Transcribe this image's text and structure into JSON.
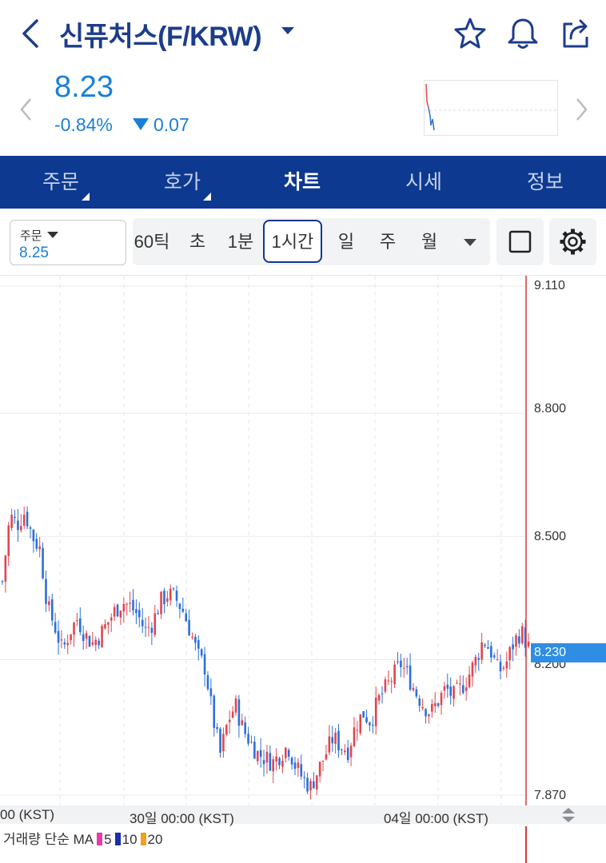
{
  "header": {
    "title": "신퓨처스(F/KRW)",
    "price": "8.23",
    "change_pct": "-0.84%",
    "change_abs": "0.07"
  },
  "nav": {
    "tabs": [
      {
        "label": "주문",
        "active": false,
        "has_submenu": true
      },
      {
        "label": "호가",
        "active": false,
        "has_submenu": true
      },
      {
        "label": "차트",
        "active": true,
        "has_submenu": false
      },
      {
        "label": "시세",
        "active": false,
        "has_submenu": false
      },
      {
        "label": "정보",
        "active": false,
        "has_submenu": false
      }
    ]
  },
  "order_box": {
    "label": "주문",
    "value": "8.25"
  },
  "timeframes": {
    "items": [
      "60틱",
      "초",
      "1분",
      "1시간",
      "일",
      "주",
      "월"
    ],
    "selected": "1시간"
  },
  "chart_data": {
    "type": "candlestick",
    "y_axis_ticks": [
      "9.110",
      "8.800",
      "8.500",
      "8.200",
      "7.870"
    ],
    "current_price_tag": "8.230",
    "x_axis_labels": [
      "00 (KST)",
      "30일 00:00 (KST)",
      "04일 00:00 (KST)"
    ],
    "ylim": [
      7.84,
      9.14
    ],
    "ohlc_path": [
      8.39,
      8.55,
      8.53,
      8.56,
      8.5,
      8.47,
      8.33,
      8.28,
      8.22,
      8.27,
      8.3,
      8.26,
      8.24,
      8.26,
      8.29,
      8.32,
      8.34,
      8.33,
      8.31,
      8.27,
      8.29,
      8.34,
      8.36,
      8.35,
      8.32,
      8.27,
      8.21,
      8.18,
      8.06,
      7.97,
      8.05,
      8.09,
      8.03,
      8.0,
      7.97,
      7.96,
      7.95,
      7.97,
      7.99,
      7.94,
      7.91,
      7.89,
      7.93,
      7.97,
      8.01,
      7.99,
      7.98,
      8.04,
      8.07,
      8.05,
      8.1,
      8.13,
      8.16,
      8.19,
      8.16,
      8.12,
      8.09,
      8.07,
      8.1,
      8.13,
      8.11,
      8.13,
      8.16,
      8.2,
      8.25,
      8.22,
      8.17,
      8.19,
      8.24,
      8.27,
      8.23
    ],
    "colors": {
      "up": "#e0464f",
      "down": "#2c6fdb"
    }
  },
  "volume_legend": {
    "title": "거래량 단순 MA",
    "items": [
      {
        "label": "5",
        "color": "#e63aa8"
      },
      {
        "label": "10",
        "color": "#1c2fa8"
      },
      {
        "label": "20",
        "color": "#f0a21c"
      }
    ]
  },
  "icons": {
    "back": "chevron-left-icon",
    "favorite": "star-icon",
    "alert": "bell-icon",
    "share": "share-icon",
    "settings": "gear-icon",
    "drawing": "square-icon"
  }
}
